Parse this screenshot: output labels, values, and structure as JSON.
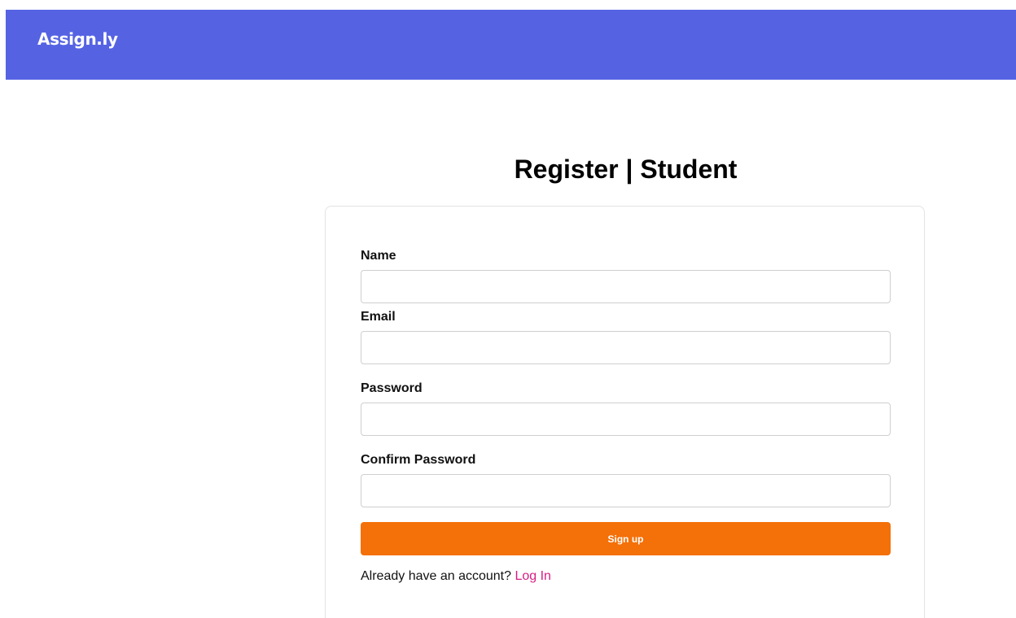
{
  "navbar": {
    "brand": "Assign.ly",
    "background_color": "#5563e3"
  },
  "page": {
    "title": "Register | Student"
  },
  "form": {
    "fields": [
      {
        "label": "Name",
        "value": "",
        "placeholder": "",
        "type": "text"
      },
      {
        "label": "Email",
        "value": "",
        "placeholder": "",
        "type": "email"
      },
      {
        "label": "Password",
        "value": "",
        "placeholder": "",
        "type": "password"
      },
      {
        "label": "Confirm Password",
        "value": "",
        "placeholder": "",
        "type": "password"
      }
    ],
    "submit_label": "Sign up",
    "submit_color": "#f47008",
    "login_prompt": "Already have an account?",
    "login_link": "Log In",
    "login_link_color": "#d61e83"
  }
}
